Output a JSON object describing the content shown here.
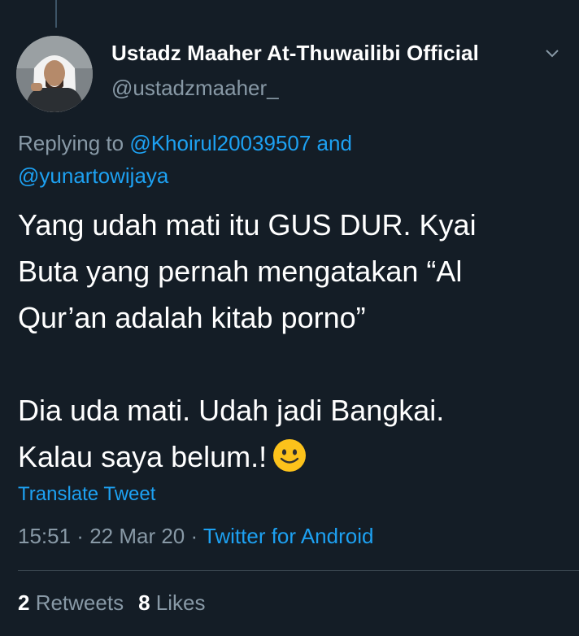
{
  "author": {
    "display_name": "Ustadz Maaher At-Thuwailibi Official",
    "handle": "@ustadzmaaher_"
  },
  "reply": {
    "prefix": "Replying to ",
    "mention_1": "@Khoirul20039507",
    "conjunction": " and",
    "mention_2": "@yunartowijaya"
  },
  "tweet": {
    "line_1": "Yang udah mati itu GUS DUR. Kyai",
    "line_2": "Buta yang pernah mengatakan “Al",
    "line_3": "Qur’an adalah kitab porno”",
    "line_4": "Dia uda mati. Udah jadi Bangkai.",
    "line_5": "Kalau saya belum.!",
    "emoji": "slightly-smiling-face-emoji"
  },
  "translate_label": "Translate Tweet",
  "meta": {
    "time": "15:51",
    "separator": " · ",
    "date": "22 Mar 20",
    "source": "Twitter for Android"
  },
  "stats": {
    "retweets_count": "2",
    "retweets_label": " Retweets",
    "likes_count": "8",
    "likes_label": " Likes"
  },
  "colors": {
    "background": "#141d26",
    "accent": "#1da1f2",
    "secondary_text": "#8899a6"
  },
  "icons": [
    "chevron-down-icon"
  ]
}
